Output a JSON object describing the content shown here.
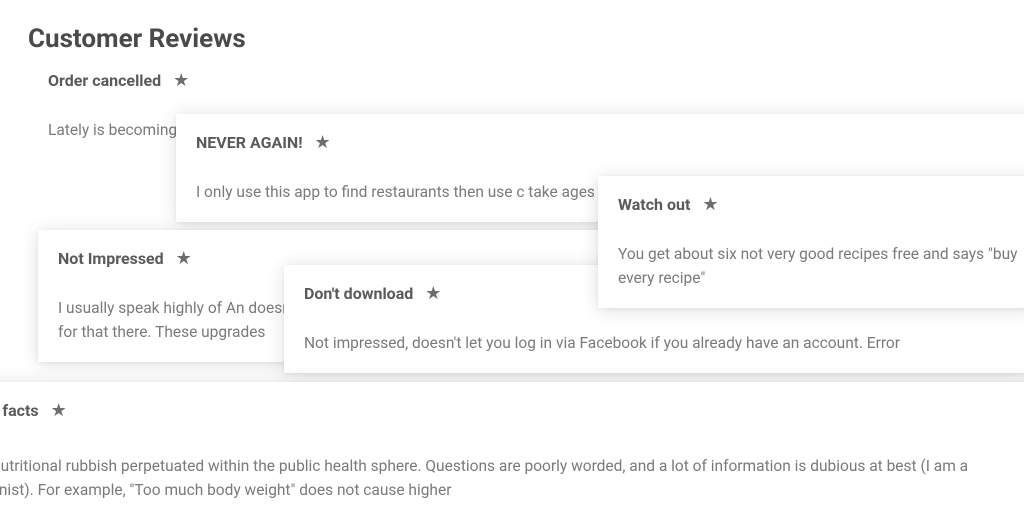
{
  "page_title": "Customer Reviews",
  "reviews": {
    "order_cancelled": {
      "title": "Order cancelled",
      "body": "Lately is becoming                                                                                               Sometimes with a                                                                                                 else, having to wai"
    },
    "never_again": {
      "title": "NEVER AGAIN!",
      "body": "I only use this app to find restaurants then use c                                                          take ages to deal with your query. Wrong phone"
    },
    "not_impressed": {
      "title": "Not Impressed",
      "body": "I usually speak highly of An                                                                                                 doesn't show my orders his                                                                                                 on. Log out is no longer in main menu but in settings. That is silly who would look for that there. These upgrades"
    },
    "dont_download": {
      "title": "Don't download",
      "body": "Not impressed, doesn't let you log in via Facebook if you already have an account. Error"
    },
    "watch_out": {
      "title": "Watch out",
      "body": "You get about six not very good recipes free and says \"buy every recipe\""
    },
    "balling_facts": {
      "title": "balling facts",
      "body": "same nutritional rubbish perpetuated within the public health sphere. Questions are poorly worded, and a lot of information is dubious at best (I am a nutritionist). For example, \"Too much body weight\" does not cause higher"
    }
  }
}
